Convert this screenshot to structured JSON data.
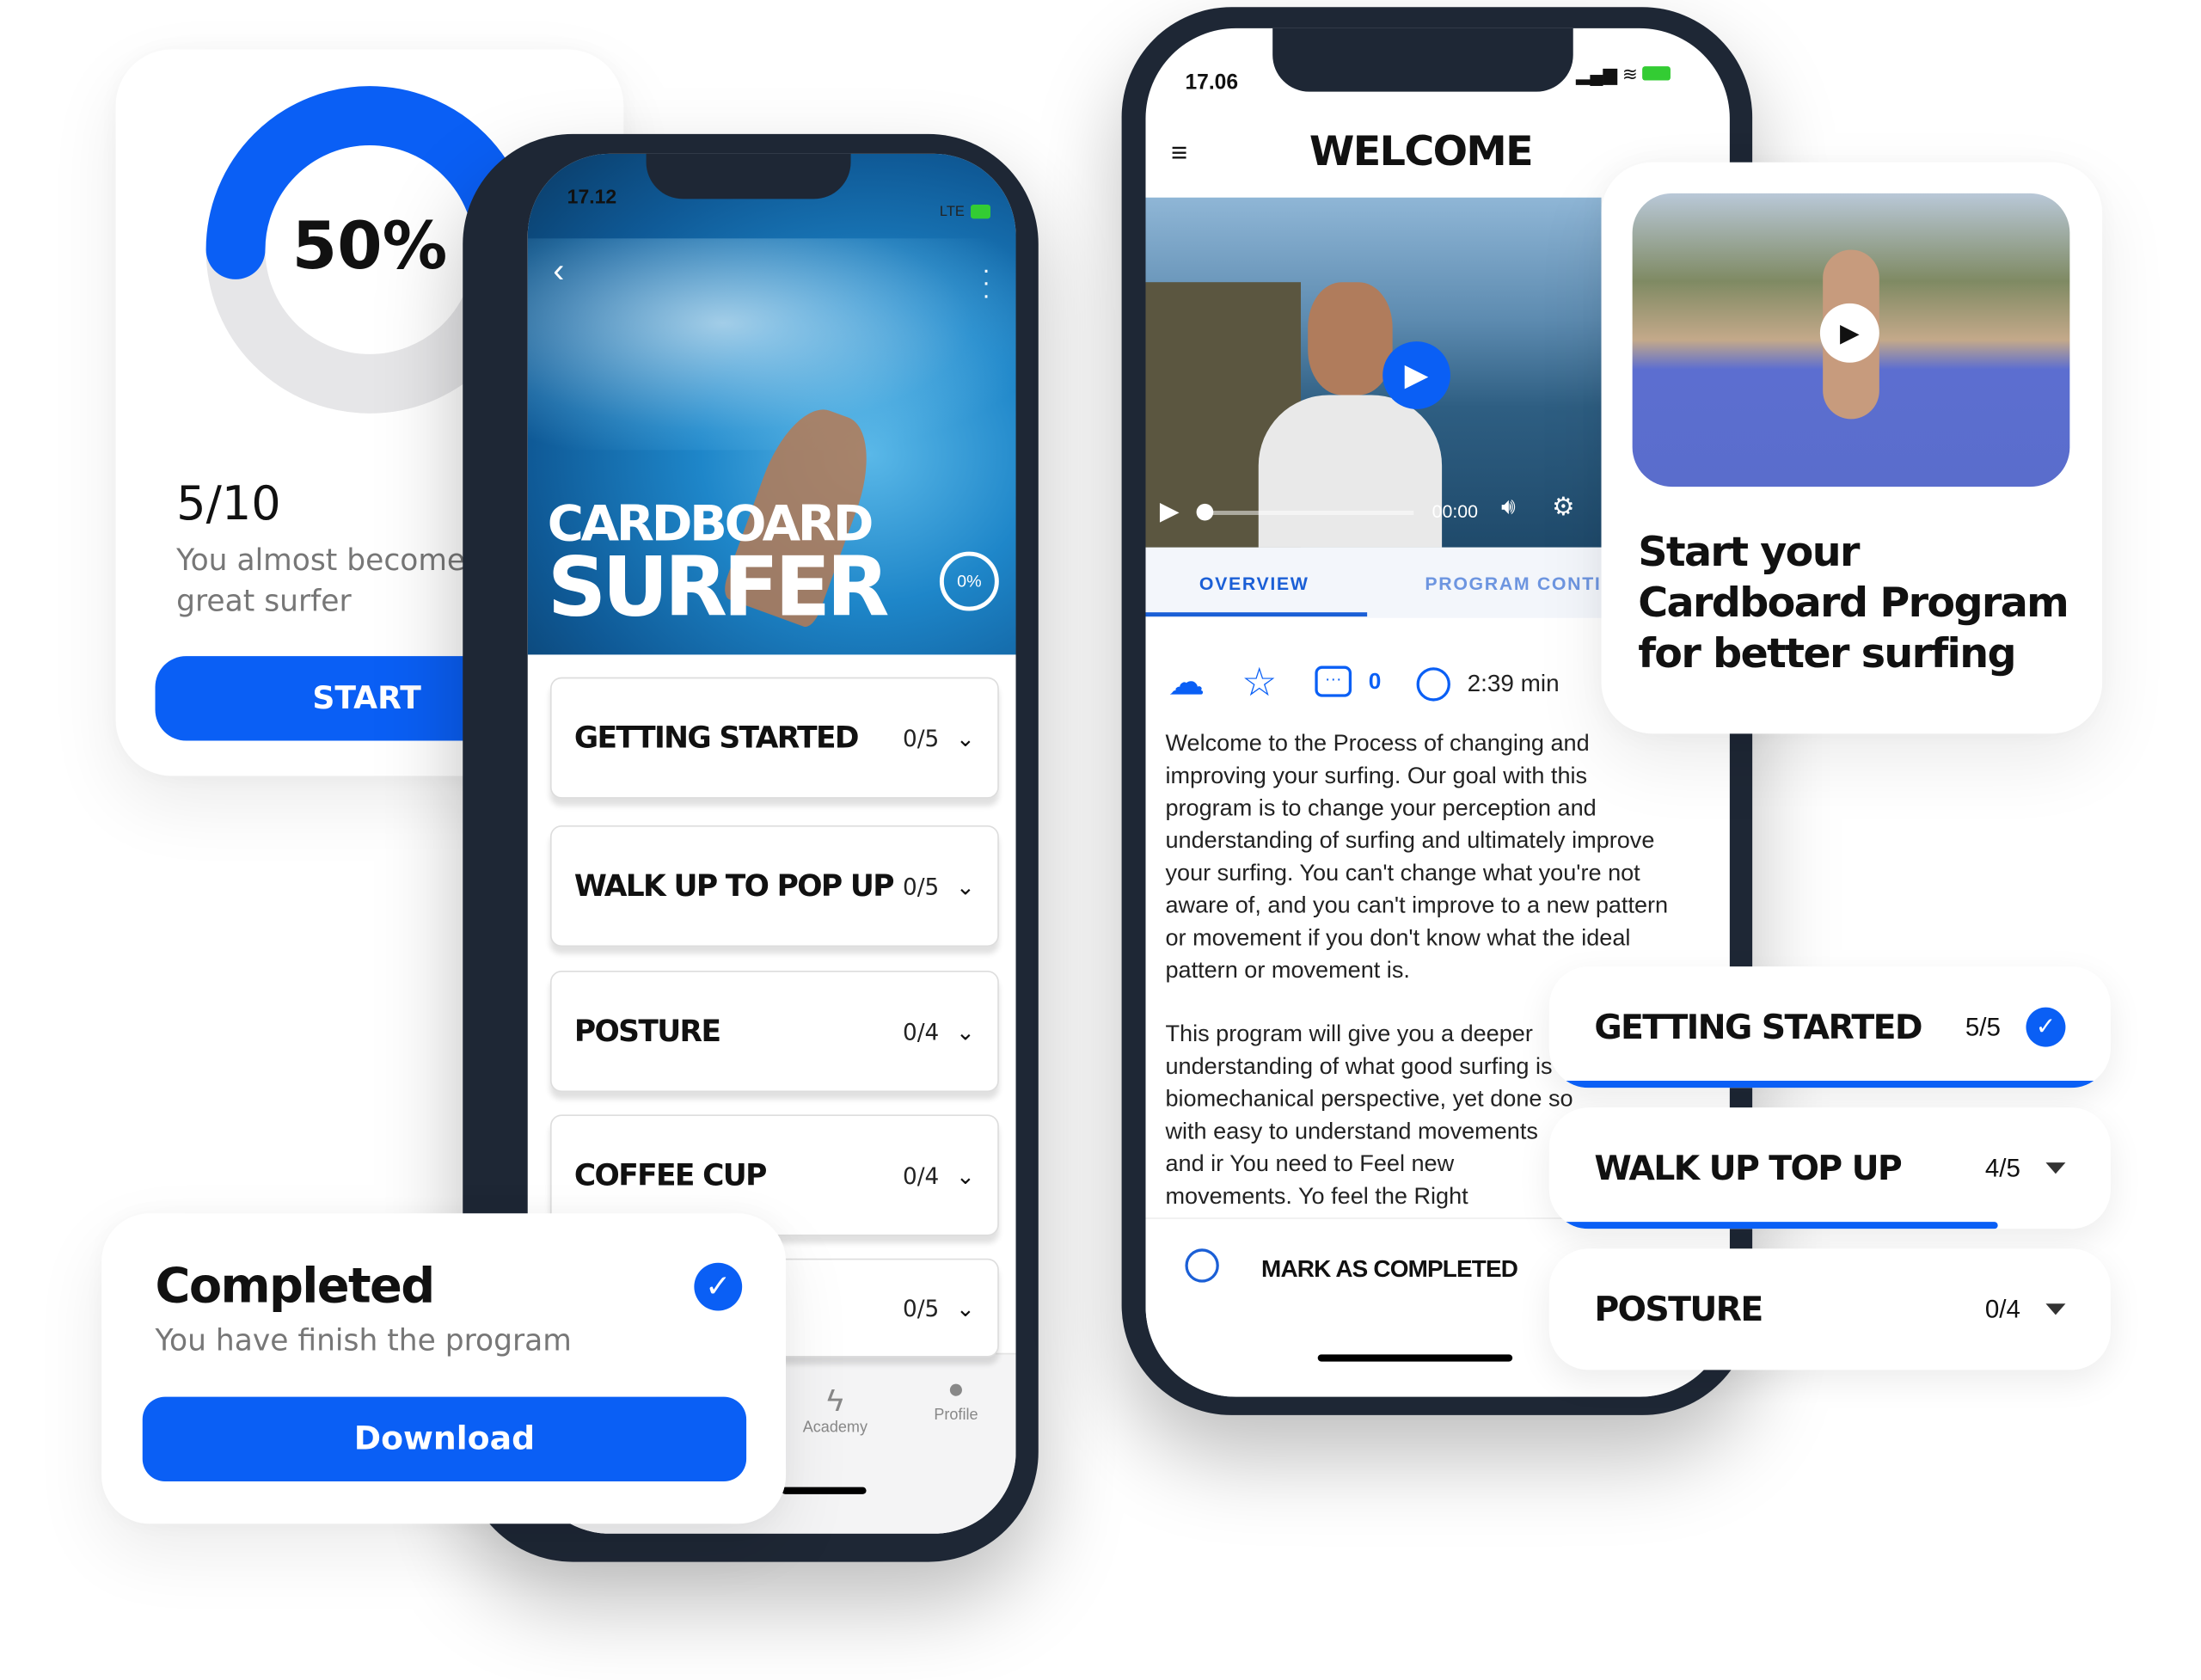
{
  "progress_card": {
    "percent_label": "50%",
    "progress": 0.5,
    "count": "5/10",
    "message": "You almost become a great surfer",
    "button": "START"
  },
  "phone_left": {
    "time": "17.12",
    "network": "LTE",
    "hero_title_line1": "CARDBOARD",
    "hero_title_line2": "SURFER",
    "hero_progress": "0%",
    "sections": [
      {
        "title": "GETTING STARTED",
        "count": "0/5"
      },
      {
        "title": "WALK UP TO POP UP",
        "count": "0/5"
      },
      {
        "title": "POSTURE",
        "count": "0/4"
      },
      {
        "title": "COFFEE CUP",
        "count": "0/4"
      },
      {
        "title": "",
        "count": "0/5"
      }
    ],
    "tabbar": [
      {
        "label": "Academy",
        "icon": "lightning-icon"
      },
      {
        "label": "Profile",
        "icon": "person-icon"
      }
    ]
  },
  "completed_card": {
    "title": "Completed",
    "message": "You have finish the program",
    "button": "Download"
  },
  "phone_right": {
    "time": "17.06",
    "title": "WELCOME",
    "video": {
      "time": "00:00"
    },
    "tabs": [
      {
        "label": "OVERVIEW",
        "active": true
      },
      {
        "label": "PROGRAM CONTI",
        "active": false
      }
    ],
    "meta": {
      "comments": "0",
      "duration": "2:39 min"
    },
    "paragraph1": "Welcome to the Process of changing and improving your surfing. Our goal with this program is to change your perception and understanding of surfing and ultimately improve your surfing. You can't change what you're not aware of, and you can't improve to a new pattern or movement if you don't know what the ideal pattern or movement is.",
    "paragraph2": "This program will give you a deeper understanding of what good surfing is biomechanical perspective, yet done so with easy to understand movements and ir You need to Feel new movements. Yo feel the Right movements. It's likely tl",
    "mark_completed": "MARK AS COMPLETED"
  },
  "start_card": {
    "title": "Start your Cardboard Program for better surfing"
  },
  "right_sections": [
    {
      "title": "GETTING STARTED",
      "count": "5/5",
      "progress": 1.0,
      "status": "completed"
    },
    {
      "title": "WALK UP TOP UP",
      "count": "4/5",
      "progress": 0.8,
      "status": "collapsed"
    },
    {
      "title": "POSTURE",
      "count": "0/4",
      "progress": 0,
      "status": "collapsed"
    }
  ],
  "colors": {
    "accent": "#0a5ff5",
    "phone_frame": "#1e2735",
    "ring_track": "#e6e6e8"
  }
}
